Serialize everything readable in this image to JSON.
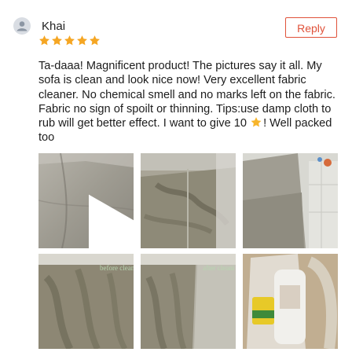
{
  "review": {
    "username": "Khai",
    "rating": 5,
    "reply_label": "Reply",
    "text_part1": "Ta-daaa! Magnificent product! The pictures say it all.  My sofa is clean and look nice now! Very excellent fabric cleaner. No chemical smell and no marks left on the fabric. Fabric no sign of spoilt or thinning.  Tips:use damp cloth to rub will get better effect. I want to give 10",
    "text_part2": "! Well packed too"
  },
  "photos": {
    "before_label": "before clean",
    "after_label": "after cleani"
  },
  "colors": {
    "accent": "#e0523a",
    "star": "#f5a623"
  },
  "icons": {
    "avatar": "person-icon",
    "rating": "star-icon",
    "video": "play-icon"
  }
}
